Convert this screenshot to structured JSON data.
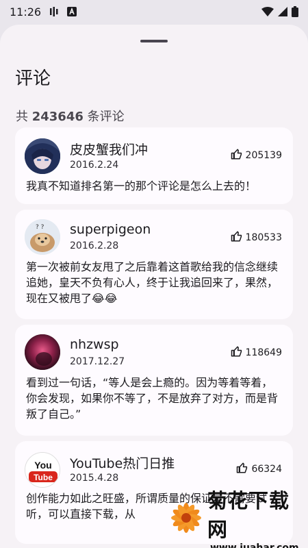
{
  "status": {
    "time": "11:26",
    "icons": [
      "signal-bars-icon",
      "a-box-icon",
      "wifi-icon",
      "cell-signal-icon",
      "battery-icon"
    ]
  },
  "sheet": {
    "title": "评论",
    "count_prefix": "共",
    "count_value": "243646",
    "count_suffix": "条评论"
  },
  "comments": [
    {
      "user": "皮皮蟹我们冲",
      "date": "2016.2.24",
      "likes": "205139",
      "text": "我真不知道排名第一的那个评论是怎么上去的！"
    },
    {
      "user": "superpigeon",
      "date": "2016.2.28",
      "likes": "180533",
      "text": "第一次被前女友甩了之后靠着这首歌给我的信念继续追她，皇天不负有心人，终于让我追回来了，果然，现在又被甩了😂😂"
    },
    {
      "user": "nhzwsp",
      "date": "2017.12.27",
      "likes": "118649",
      "text": "看到过一句话，“等人是会上瘾的。因为等着等着，你会发现，如果你不等了，不是放弃了对方，而是背叛了自己。”"
    },
    {
      "user": "YouTube热门日推",
      "date": "2015.4.28",
      "likes": "66324",
      "text": "创作能力如此之旺盛，所谓质量的保证是不需要试听，可以直接下载，从"
    }
  ],
  "avatars": {
    "youtube_you": "You",
    "youtube_tube": "Tube"
  },
  "watermark": {
    "title": "菊花下载网",
    "url": "www.juahar.com"
  },
  "colors": {
    "background": "#e9e6ec",
    "sheet": "#f6f2f6",
    "card": "#fefbff",
    "youtube_red": "#d9261c"
  }
}
